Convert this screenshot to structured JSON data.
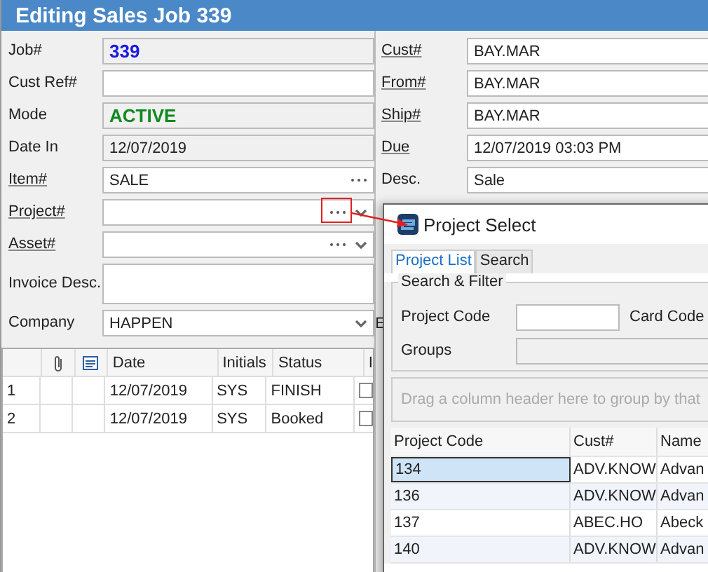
{
  "window": {
    "title": "Editing Sales Job 339"
  },
  "left_fields": [
    {
      "label": "Job#",
      "link": false,
      "kind": "id",
      "value": "339"
    },
    {
      "label": "Cust Ref#",
      "link": false,
      "kind": "text"
    },
    {
      "label": "Mode",
      "link": false,
      "kind": "status",
      "value": "ACTIVE"
    },
    {
      "label": "Date In",
      "link": false,
      "kind": "readonly",
      "value": "12/07/2019"
    },
    {
      "label": "Item#",
      "link": true,
      "kind": "lookup",
      "value": "SALE"
    },
    {
      "label": "Project#",
      "link": true,
      "kind": "lookup_combo"
    },
    {
      "label": "Asset#",
      "link": true,
      "kind": "lookup_combo"
    },
    {
      "label": "Invoice Desc.",
      "link": false,
      "kind": "memo"
    },
    {
      "label": "Company",
      "link": false,
      "kind": "combo",
      "value": "HAPPEN",
      "side_label": "E"
    }
  ],
  "right_fields": [
    {
      "label": "Cust#",
      "link": true,
      "value": "BAY.MAR"
    },
    {
      "label": "From#",
      "link": true,
      "value": "BAY.MAR"
    },
    {
      "label": "Ship#",
      "link": true,
      "value": "BAY.MAR"
    },
    {
      "label": "Due",
      "link": true,
      "value": "12/07/2019 03:03 PM"
    },
    {
      "label": "Desc.",
      "link": false,
      "value": "Sale"
    }
  ],
  "history_table": {
    "columns": [
      {
        "kind": "blank"
      },
      {
        "kind": "attachment"
      },
      {
        "kind": "note"
      },
      {
        "kind": "text",
        "label": "Date"
      },
      {
        "kind": "text",
        "label": "Initials"
      },
      {
        "kind": "text",
        "label": "Status"
      },
      {
        "kind": "text",
        "label": "I"
      }
    ],
    "rows": [
      {
        "number": "1",
        "date": "12/07/2019",
        "initials": "SYS",
        "status": "FINISH",
        "checked": false
      },
      {
        "number": "2",
        "date": "12/07/2019",
        "initials": "SYS",
        "status": "Booked",
        "checked": false
      }
    ]
  },
  "project_select": {
    "title": "Project Select",
    "tabs": [
      {
        "label": "Project List",
        "selected": true
      },
      {
        "label": "Search",
        "selected": false
      }
    ],
    "filter_group": {
      "title": "Search & Filter",
      "project_code_label": "Project Code",
      "card_code_label": "Card Code",
      "groups_label": "Groups"
    },
    "group_panel_hint": "Drag a column header here to group by that",
    "columns": [
      "Project Code",
      "Cust#",
      "Name"
    ],
    "rows": [
      {
        "cells": [
          "134",
          "ADV.KNOW",
          "Advan"
        ],
        "selected": true
      },
      {
        "cells": [
          "136",
          "ADV.KNOW",
          "Advan"
        ],
        "selected": false
      },
      {
        "cells": [
          "137",
          "ABEC.HO",
          "Abeck"
        ],
        "selected": false
      },
      {
        "cells": [
          "140",
          "ADV.KNOW",
          "Advan"
        ],
        "selected": false
      }
    ]
  }
}
